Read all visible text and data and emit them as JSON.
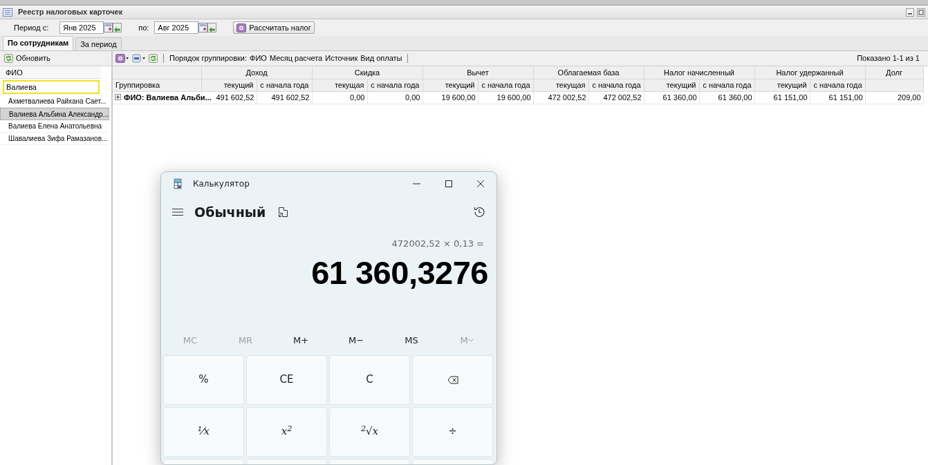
{
  "window": {
    "title": "Реестр налоговых карточек"
  },
  "period": {
    "from_label": "Период с:",
    "from_value": "Янв 2025",
    "to_label": "по:",
    "to_value": "Авг 2025"
  },
  "calc_button": "Рассчитать налог",
  "tabs": [
    {
      "label": "По сотрудникам",
      "selected": true
    },
    {
      "label": "За период",
      "selected": false
    }
  ],
  "employees_panel": {
    "refresh": "Обновить",
    "column": "ФИО",
    "filter": "Валиева",
    "items": [
      {
        "name": "Ахметвалиева Райхана Сает...",
        "selected": false
      },
      {
        "name": "Валиева Альбина Александр...",
        "selected": true
      },
      {
        "name": "Валиева Елена Анатольевна",
        "selected": false
      },
      {
        "name": "Шавалиева Зифа Рамазанов...",
        "selected": false
      }
    ]
  },
  "grid_toolbar": {
    "grouping_label": "Порядок группировки:",
    "grouping": [
      "ФИО",
      "Месяц расчета",
      "Источник",
      "Вид оплаты"
    ],
    "pager": "Показано 1-1 из 1"
  },
  "table": {
    "first_column": "Группировка",
    "groups": [
      {
        "title": "Доход",
        "columns": [
          "текущий",
          "с начала года"
        ]
      },
      {
        "title": "Скидка",
        "columns": [
          "текущая",
          "с начала года"
        ]
      },
      {
        "title": "Вычет",
        "columns": [
          "текущий",
          "с начала года"
        ]
      },
      {
        "title": "Облагаемая база",
        "columns": [
          "текущая",
          "с начала года"
        ]
      },
      {
        "title": "Налог начисленный",
        "columns": [
          "текущий",
          "с начала года"
        ]
      },
      {
        "title": "Налог удержанный",
        "columns": [
          "текущий",
          "с начала года"
        ]
      },
      {
        "title": "Долг"
      }
    ],
    "rows": [
      {
        "label": "ФИО: Валиева Альби...",
        "expanded": false,
        "cells": [
          "491 602,52",
          "491 602,52",
          "0,00",
          "0,00",
          "19 600,00",
          "19 600,00",
          "472 002,52",
          "472 002,52",
          "61 360,00",
          "61 360,00",
          "61 151,00",
          "61 151,00",
          "209,00"
        ]
      }
    ]
  },
  "calculator": {
    "title": "Калькулятор",
    "mode": "Обычный",
    "expression": "472002,52 × 0,13 =",
    "result": "61 360,3276",
    "memory": [
      {
        "label": "MC",
        "disabled": true
      },
      {
        "label": "MR",
        "disabled": true
      },
      {
        "label": "M+",
        "disabled": false
      },
      {
        "label": "M−",
        "disabled": false
      },
      {
        "label": "MS",
        "disabled": false
      },
      {
        "label": "M",
        "disabled": true,
        "kind": "menu"
      }
    ],
    "keys": [
      {
        "kind": "text",
        "label": "%"
      },
      {
        "kind": "text",
        "label": "CE"
      },
      {
        "kind": "text",
        "label": "C"
      },
      {
        "kind": "backspace"
      },
      {
        "kind": "math",
        "label": "¹⁄x"
      },
      {
        "kind": "math",
        "label": "x$^{2}$"
      },
      {
        "kind": "math",
        "label": "$^{2}$√x"
      },
      {
        "kind": "text",
        "label": "÷"
      },
      {
        "kind": "blank"
      },
      {
        "kind": "blank"
      },
      {
        "kind": "blank"
      },
      {
        "kind": "blank"
      }
    ]
  }
}
